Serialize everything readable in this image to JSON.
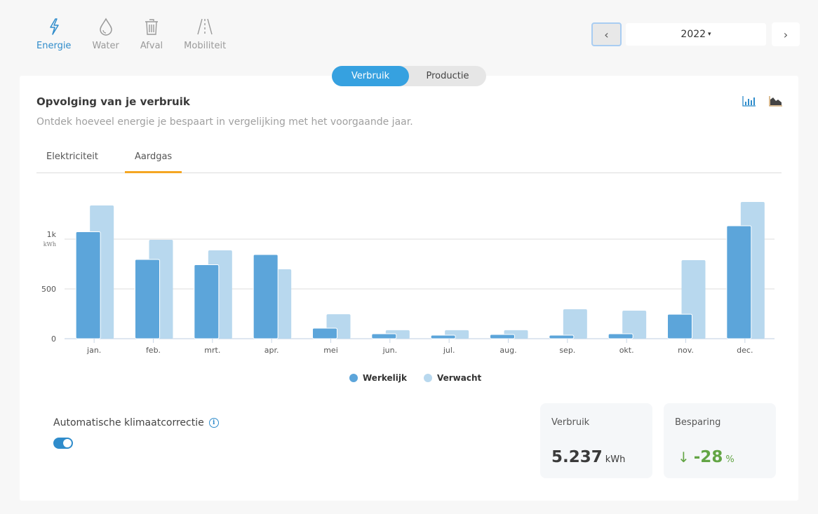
{
  "nav": [
    {
      "label": "Energie",
      "icon": "lightning-icon",
      "active": true
    },
    {
      "label": "Water",
      "icon": "water-drop-icon",
      "active": false
    },
    {
      "label": "Afval",
      "icon": "trash-icon",
      "active": false
    },
    {
      "label": "Mobiliteit",
      "icon": "road-icon",
      "active": false
    }
  ],
  "year": {
    "prev_icon": "‹",
    "value": "2022",
    "caret": "▾",
    "next_icon": "›"
  },
  "segment": {
    "options": [
      "Verbruik",
      "Productie"
    ],
    "selected": "Verbruik"
  },
  "card": {
    "title": "Opvolging van je verbruik",
    "subtitle": "Ontdek hoeveel energie je bespaart in vergelijking met het voorgaande jaar.",
    "tabs": [
      "Elektriciteit",
      "Aardgas"
    ],
    "active_tab": "Aardgas"
  },
  "colors": {
    "actual": "#5ca5da",
    "expected": "#b8d8ee",
    "accent": "#36a1e0",
    "tab_underline": "#f5a623",
    "saving": "#63a545"
  },
  "legend": {
    "actual": "Werkelijk",
    "expected": "Verwacht"
  },
  "klimaat": {
    "label": "Automatische klimaatcorrectie",
    "info_icon": "i",
    "enabled": true
  },
  "stats": {
    "verbruik": {
      "label": "Verbruik",
      "value": "5.237",
      "unit": "kWh"
    },
    "besparing": {
      "label": "Besparing",
      "arrow": "↓",
      "value": "-28",
      "unit": "%"
    }
  },
  "chart_data": {
    "type": "bar",
    "categories": [
      "jan.",
      "feb.",
      "mrt.",
      "apr.",
      "mei",
      "jun.",
      "jul.",
      "aug.",
      "sep.",
      "okt.",
      "nov.",
      "dec."
    ],
    "series": [
      {
        "name": "Werkelijk",
        "values": [
          1074,
          796,
          743,
          845,
          106,
          49,
          35,
          42,
          35,
          49,
          246,
          1134
        ]
      },
      {
        "name": "Verwacht",
        "values": [
          1338,
          993,
          887,
          697,
          246,
          85,
          85,
          85,
          296,
          282,
          789,
          1373
        ]
      }
    ],
    "yticks": [
      {
        "value": 0,
        "label": "0"
      },
      {
        "value": 500,
        "label": "500"
      },
      {
        "value": 1000,
        "label": "1k"
      }
    ],
    "ylabel": "kWh",
    "ylim": [
      0,
      1400
    ],
    "grid": true,
    "legend_position": "bottom-center"
  }
}
